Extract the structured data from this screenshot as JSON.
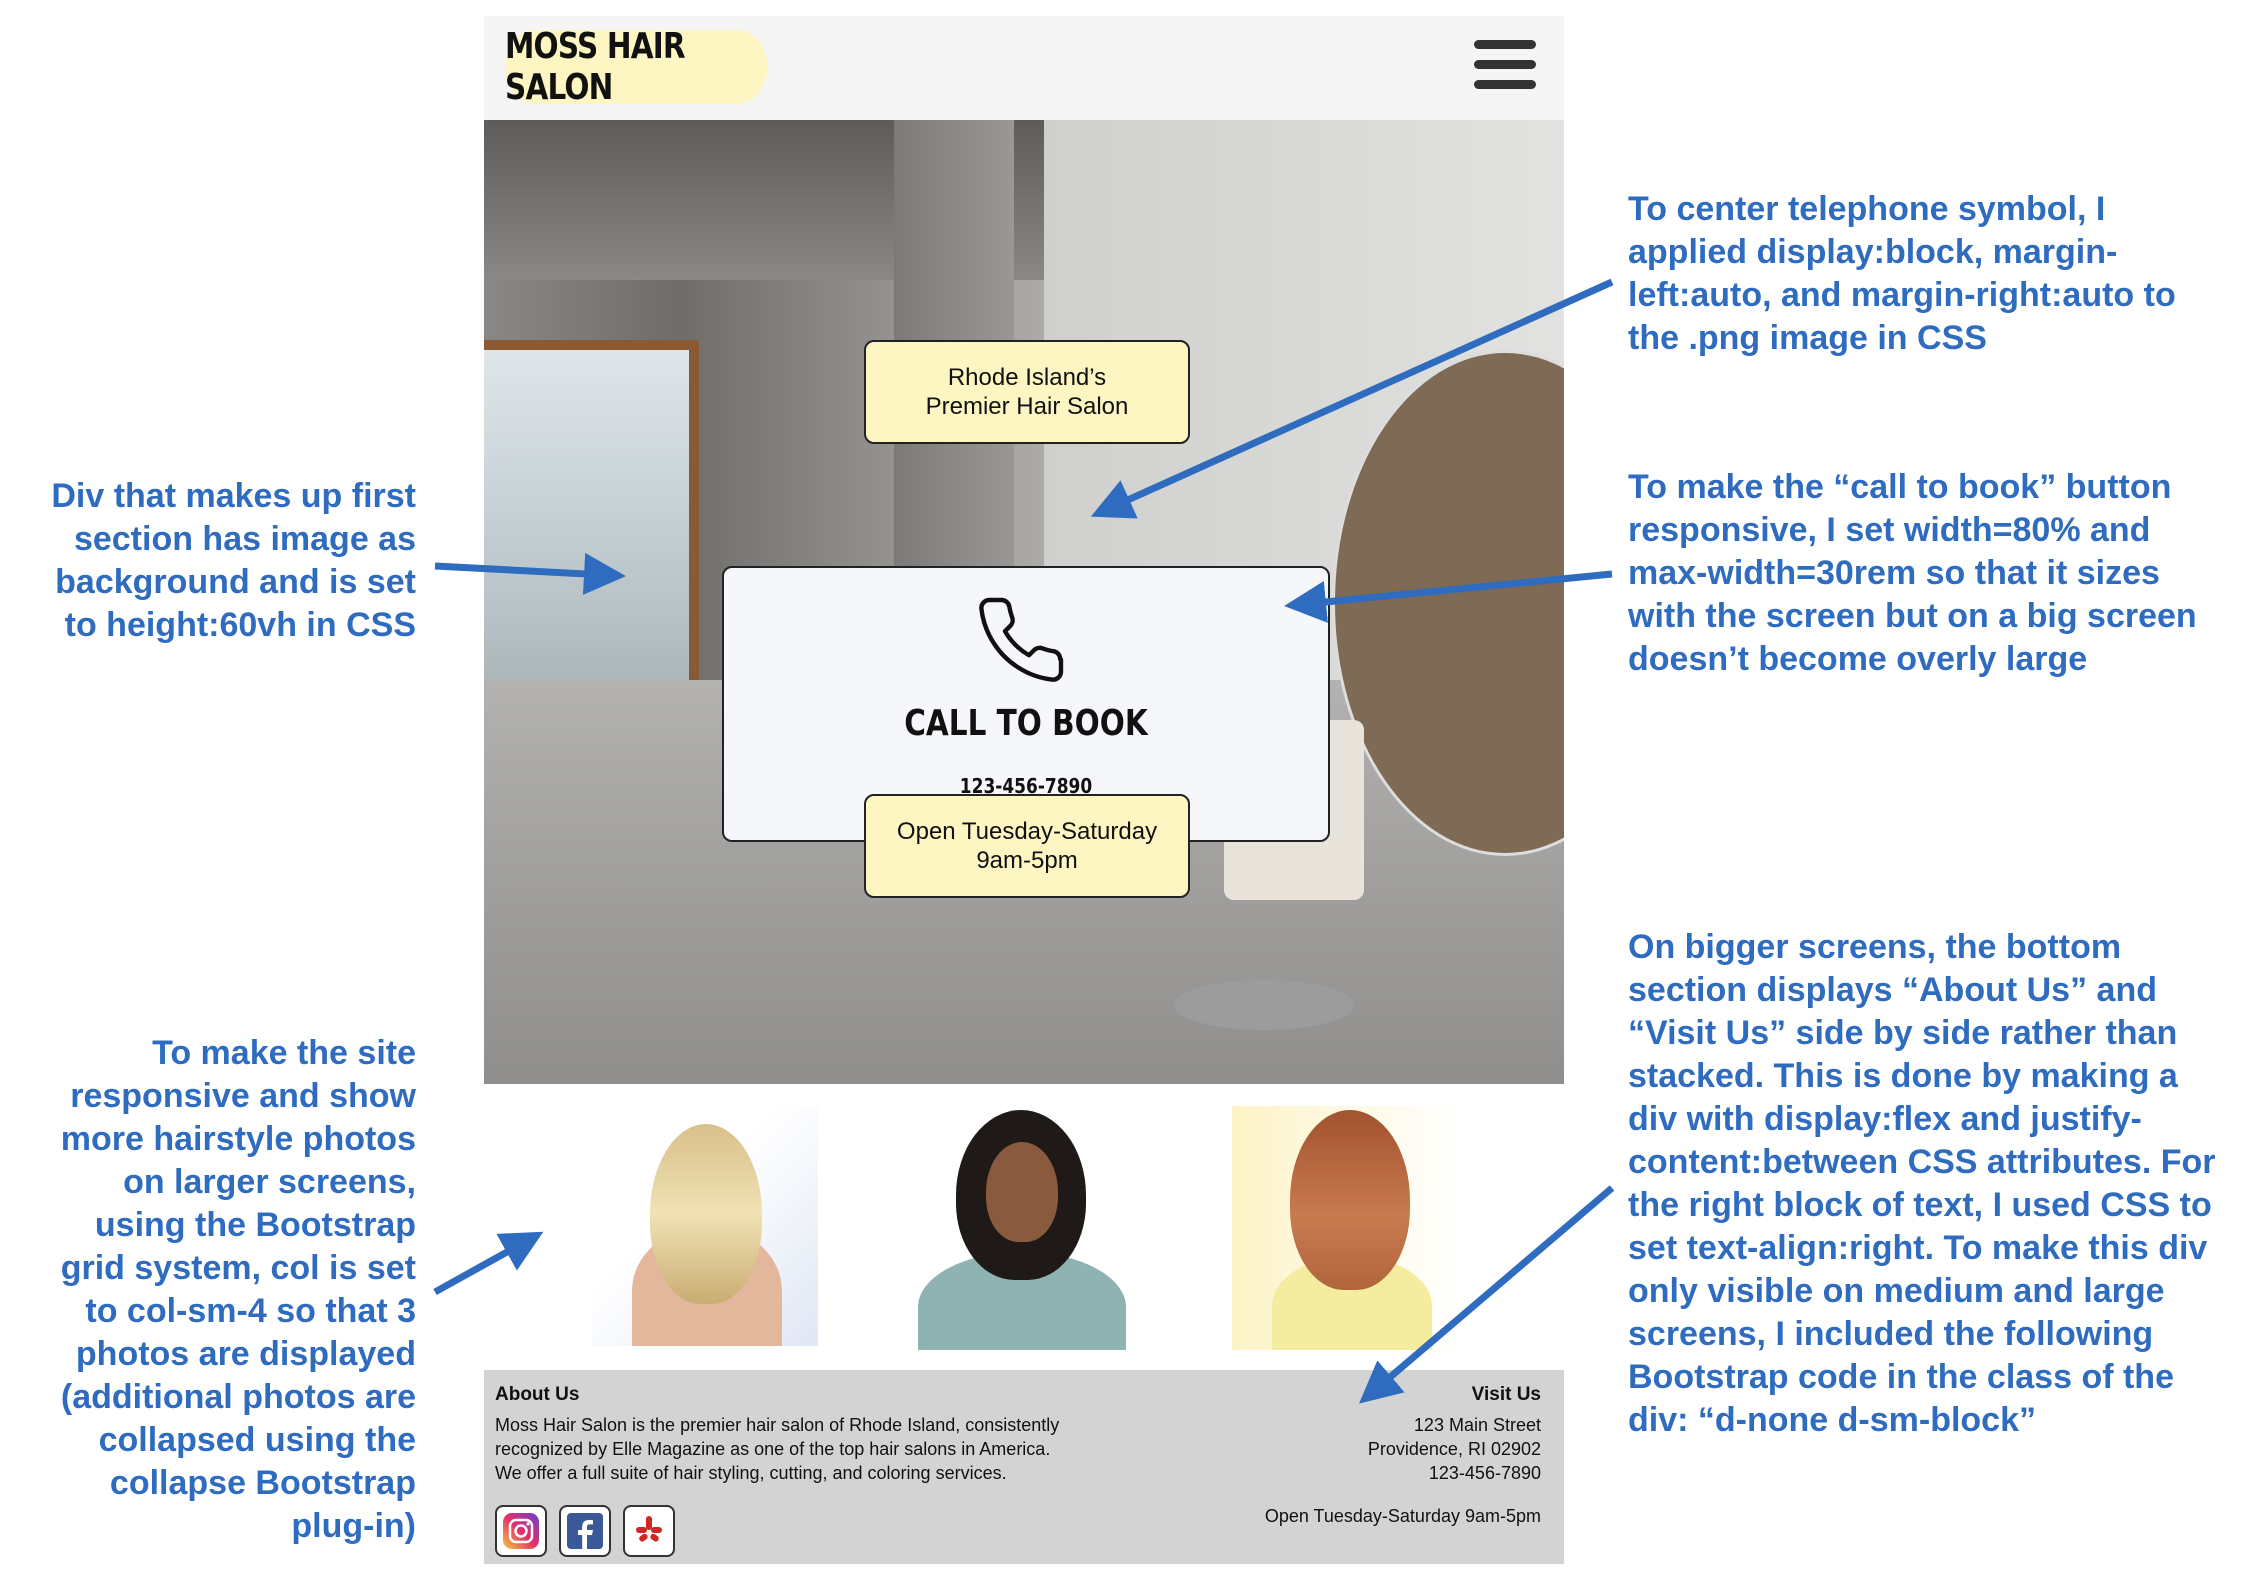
{
  "site": {
    "brand": "MOSS HAIR SALON",
    "hero": {
      "tagline_line1": "Rhode Island’s",
      "tagline_line2": "Premier Hair Salon",
      "call_title": "CALL TO BOOK",
      "call_number": "123-456-7890",
      "hours_line1": "Open Tuesday-Saturday",
      "hours_line2": "9am-5pm"
    },
    "footer": {
      "about_heading": "About Us",
      "about_line1": "Moss Hair Salon is the premier hair salon of Rhode Island, consistently",
      "about_line2": "recognized by Elle Magazine as one of the top hair salons in America.",
      "about_line3": "We offer a full suite of hair styling, cutting, and coloring services.",
      "visit_heading": "Visit Us",
      "street": "123 Main Street",
      "city": "Providence, RI 02902",
      "phone": "123-456-7890",
      "hours": "Open Tuesday-Saturday 9am-5pm",
      "social_icons": [
        "instagram-icon",
        "facebook-icon",
        "yelp-icon"
      ]
    }
  },
  "annotations": {
    "left_hero": [
      "Div that makes up first",
      "section has image as",
      "background and is set",
      "to height:60vh in CSS"
    ],
    "left_photos": [
      "To make the site",
      "responsive and show",
      "more hairstyle photos",
      "on larger screens,",
      "using the Bootstrap",
      "grid system, col is set",
      "to col-sm-4 so that 3",
      "photos are displayed",
      "(additional photos are",
      "collapsed using the",
      "collapse Bootstrap",
      "plug-in)"
    ],
    "right_phone": [
      "To center telephone symbol, I",
      "applied display:block, margin-",
      "left:auto, and margin-right:auto to",
      "the .png image in CSS"
    ],
    "right_button": [
      "To make the “call to book” button",
      "responsive, I set width=80% and",
      "max-width=30rem so that it sizes",
      "with the screen but on a big screen",
      "doesn’t become overly large"
    ],
    "right_footer": [
      "On bigger screens, the bottom",
      "section displays “About Us” and",
      "“Visit Us” side by side rather than",
      "stacked. This is done by making a",
      "div with display:flex and justify-",
      "content:between CSS attributes. For",
      "the right block of text, I used CSS to",
      "set text-align:right. To make this div",
      "only visible on medium and large",
      "screens, I included the following",
      "Bootstrap code in the class of the",
      "div: “d-none d-sm-block”"
    ]
  },
  "colors": {
    "annotation": "#2f6cc0",
    "brand_bg": "#fdf6c3",
    "footer_bg": "#d3d3d3",
    "call_box_bg": "#f6f7fb"
  }
}
